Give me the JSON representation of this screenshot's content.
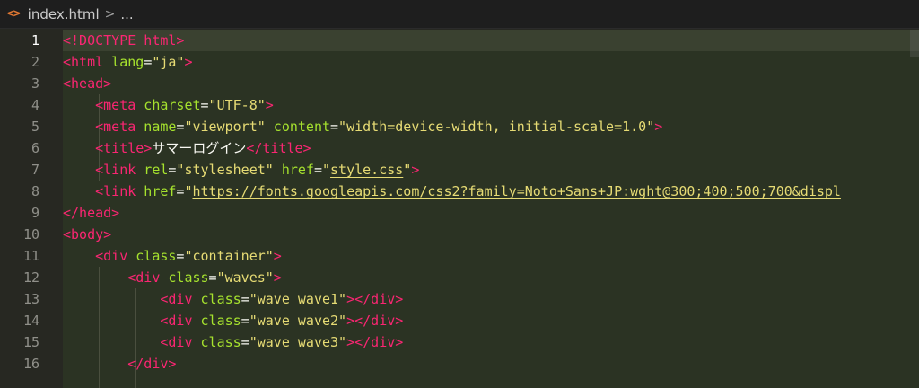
{
  "breadcrumb": {
    "file_icon": "<>",
    "file_name": "index.html",
    "separator": ">",
    "more": "..."
  },
  "editor": {
    "active_line": 1,
    "lines": [
      {
        "number": "1",
        "indent": 0,
        "tokens": [
          [
            "tag",
            "<!DOCTYPE html>"
          ]
        ]
      },
      {
        "number": "2",
        "indent": 0,
        "tokens": [
          [
            "tag",
            "<html "
          ],
          [
            "attr",
            "lang"
          ],
          [
            "txt",
            "="
          ],
          [
            "str",
            "\"ja\""
          ],
          [
            "tag",
            ">"
          ]
        ]
      },
      {
        "number": "3",
        "indent": 0,
        "tokens": [
          [
            "tag",
            "<head>"
          ]
        ]
      },
      {
        "number": "4",
        "indent": 1,
        "tokens": [
          [
            "tag",
            "<meta "
          ],
          [
            "attr",
            "charset"
          ],
          [
            "txt",
            "="
          ],
          [
            "str",
            "\"UTF-8\""
          ],
          [
            "tag",
            ">"
          ]
        ]
      },
      {
        "number": "5",
        "indent": 1,
        "tokens": [
          [
            "tag",
            "<meta "
          ],
          [
            "attr",
            "name"
          ],
          [
            "txt",
            "="
          ],
          [
            "str",
            "\"viewport\""
          ],
          [
            "txt",
            " "
          ],
          [
            "attr",
            "content"
          ],
          [
            "txt",
            "="
          ],
          [
            "str",
            "\"width=device-width, initial-scale=1.0\""
          ],
          [
            "tag",
            ">"
          ]
        ]
      },
      {
        "number": "6",
        "indent": 1,
        "tokens": [
          [
            "tag",
            "<title>"
          ],
          [
            "txt",
            "サマーログイン"
          ],
          [
            "tag",
            "</title>"
          ]
        ]
      },
      {
        "number": "7",
        "indent": 1,
        "tokens": [
          [
            "tag",
            "<link "
          ],
          [
            "attr",
            "rel"
          ],
          [
            "txt",
            "="
          ],
          [
            "str",
            "\"stylesheet\""
          ],
          [
            "txt",
            " "
          ],
          [
            "attr",
            "href"
          ],
          [
            "txt",
            "="
          ],
          [
            "str",
            "\""
          ],
          [
            "link",
            "style.css"
          ],
          [
            "str",
            "\""
          ],
          [
            "tag",
            ">"
          ]
        ]
      },
      {
        "number": "8",
        "indent": 1,
        "tokens": [
          [
            "tag",
            "<link "
          ],
          [
            "attr",
            "href"
          ],
          [
            "txt",
            "="
          ],
          [
            "str",
            "\""
          ],
          [
            "link",
            "https://fonts.googleapis.com/css2?family=Noto+Sans+JP:wght@300;400;500;700&displ"
          ]
        ]
      },
      {
        "number": "9",
        "indent": 0,
        "tokens": [
          [
            "tag",
            "</head>"
          ]
        ]
      },
      {
        "number": "10",
        "indent": 0,
        "tokens": [
          [
            "tag",
            "<body>"
          ]
        ]
      },
      {
        "number": "11",
        "indent": 1,
        "tokens": [
          [
            "tag",
            "<div "
          ],
          [
            "attr",
            "class"
          ],
          [
            "txt",
            "="
          ],
          [
            "str",
            "\"container\""
          ],
          [
            "tag",
            ">"
          ]
        ]
      },
      {
        "number": "12",
        "indent": 2,
        "tokens": [
          [
            "tag",
            "<div "
          ],
          [
            "attr",
            "class"
          ],
          [
            "txt",
            "="
          ],
          [
            "str",
            "\"waves\""
          ],
          [
            "tag",
            ">"
          ]
        ]
      },
      {
        "number": "13",
        "indent": 3,
        "tokens": [
          [
            "tag",
            "<div "
          ],
          [
            "attr",
            "class"
          ],
          [
            "txt",
            "="
          ],
          [
            "str",
            "\"wave wave1\""
          ],
          [
            "tag",
            "></div>"
          ]
        ]
      },
      {
        "number": "14",
        "indent": 3,
        "tokens": [
          [
            "tag",
            "<div "
          ],
          [
            "attr",
            "class"
          ],
          [
            "txt",
            "="
          ],
          [
            "str",
            "\"wave wave2\""
          ],
          [
            "tag",
            "></div>"
          ]
        ]
      },
      {
        "number": "15",
        "indent": 3,
        "tokens": [
          [
            "tag",
            "<div "
          ],
          [
            "attr",
            "class"
          ],
          [
            "txt",
            "="
          ],
          [
            "str",
            "\"wave wave3\""
          ],
          [
            "tag",
            "></div>"
          ]
        ]
      },
      {
        "number": "16",
        "indent": 2,
        "tokens": [
          [
            "tag",
            "</div>"
          ]
        ]
      }
    ]
  }
}
